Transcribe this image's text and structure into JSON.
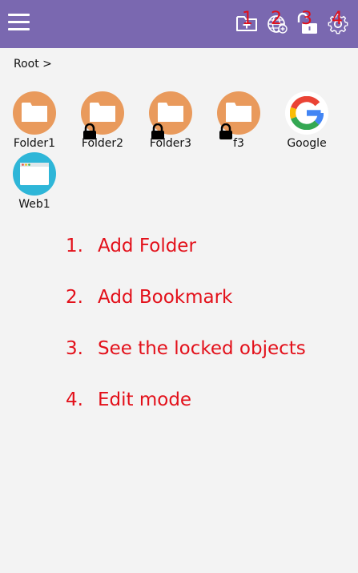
{
  "colors": {
    "topbar": "#7a68b0",
    "background": "#f3f3f3",
    "folder": "#e99a5c",
    "web": "#2eb6d8",
    "annotation": "#e3101a"
  },
  "toolbar": {
    "menu_icon": "hamburger-menu-icon",
    "buttons": [
      {
        "icon": "add-folder-icon",
        "marker": "1"
      },
      {
        "icon": "add-bookmark-globe-icon",
        "marker": "2"
      },
      {
        "icon": "unlock-icon",
        "marker": "3"
      },
      {
        "icon": "gear-icon",
        "marker": "4"
      }
    ]
  },
  "breadcrumb": "Root >",
  "items": [
    {
      "label": "Folder1",
      "type": "folder",
      "locked": false
    },
    {
      "label": "Folder2",
      "type": "folder",
      "locked": true
    },
    {
      "label": "Folder3",
      "type": "folder",
      "locked": true
    },
    {
      "label": "f3",
      "type": "folder",
      "locked": true
    },
    {
      "label": "Google",
      "type": "bookmark",
      "icon": "google-icon"
    },
    {
      "label": "Web1",
      "type": "bookmark",
      "icon": "browser-window-icon"
    }
  ],
  "steps": [
    {
      "num": "1.",
      "text": "Add Folder"
    },
    {
      "num": "2.",
      "text": "Add Bookmark"
    },
    {
      "num": "3.",
      "text": "See the locked objects"
    },
    {
      "num": "4.",
      "text": "Edit mode"
    }
  ]
}
